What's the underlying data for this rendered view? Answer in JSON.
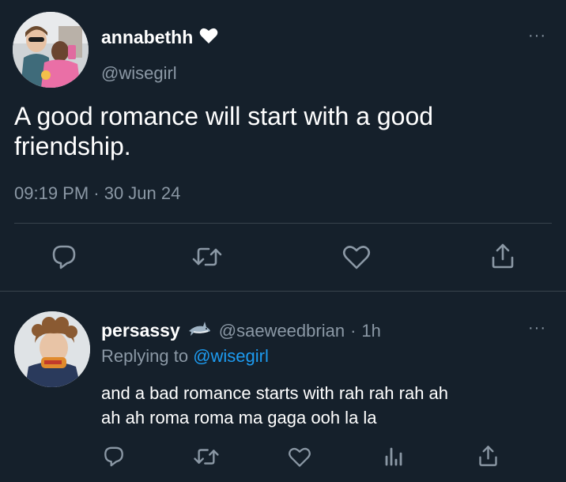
{
  "tweet": {
    "author_name": "annabethh",
    "author_badge": "white-heart",
    "author_handle": "@wisegirl",
    "text": "A good romance will start with a good friendship.",
    "timestamp": "09:19 PM · 30 Jun 24",
    "more_label": "···",
    "actions": [
      "reply-icon",
      "retweet-icon",
      "like-icon",
      "share-icon"
    ]
  },
  "reply": {
    "author_name": "persassy",
    "author_badge": "shark-emoji",
    "author_handle": "@saeweedbrian",
    "separator": "·",
    "time": "1h",
    "replying_prefix": "Replying to",
    "replying_to": "@wisegirl",
    "text_line1": "and a bad romance starts with rah rah rah ah",
    "text_line2": "ah ah roma roma ma gaga ooh la la",
    "more_label": "···",
    "actions": [
      "reply-icon",
      "retweet-icon",
      "like-icon",
      "analytics-icon",
      "share-icon"
    ]
  },
  "colors": {
    "background": "#15202b",
    "secondary_text": "#8b98a5",
    "link": "#1d9bf0",
    "divider": "#38444d"
  }
}
